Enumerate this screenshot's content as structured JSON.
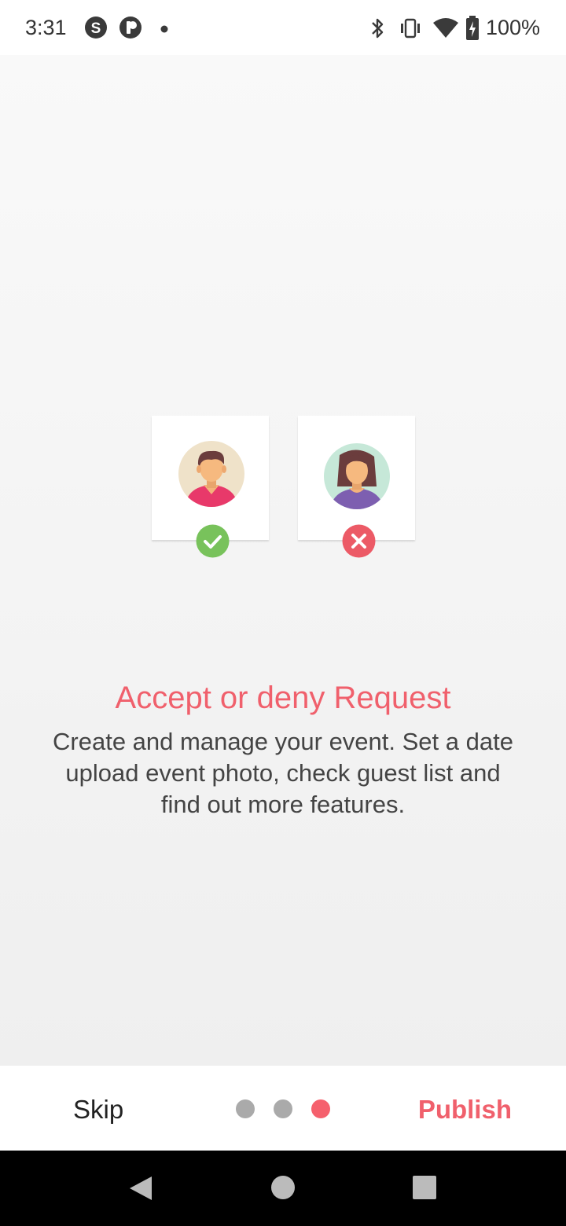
{
  "status_bar": {
    "time": "3:31",
    "battery_text": "100%",
    "icons": [
      "skype-icon",
      "app-notification-icon",
      "notification-dot-icon",
      "bluetooth-icon",
      "vibrate-icon",
      "wifi-icon",
      "battery-charging-icon"
    ]
  },
  "illustration": {
    "accepted_label": "accepted",
    "denied_label": "denied",
    "accept_color": "#78c25b",
    "deny_color": "#ec5a66"
  },
  "onboarding": {
    "title": "Accept or deny Request",
    "description": "Create and manage your event. Set a date upload event photo, check guest list and find out more features.",
    "page_index": 3,
    "page_count": 3
  },
  "bottom_bar": {
    "skip_label": "Skip",
    "publish_label": "Publish"
  },
  "colors": {
    "accent": "#f0606c",
    "dot_inactive": "#aaaaaa",
    "dot_active": "#f5606d"
  },
  "nav_bar": {
    "icons": [
      "back-icon",
      "home-icon",
      "recents-icon"
    ]
  }
}
